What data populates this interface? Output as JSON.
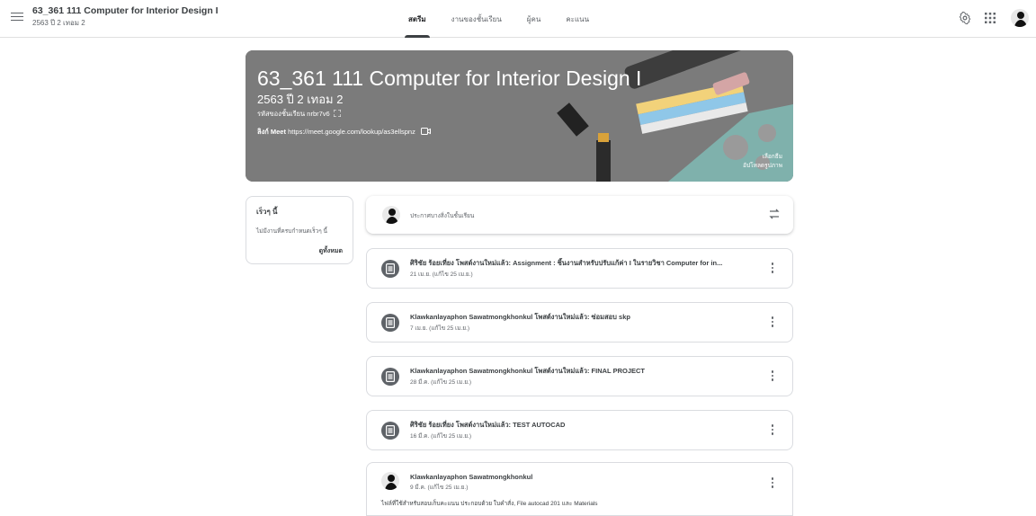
{
  "header": {
    "class_title": "63_361 111 Computer for Interior Design I",
    "class_subtitle": "2563 ปี 2 เทอม 2",
    "tabs": [
      {
        "label": "สตรีม",
        "active": true
      },
      {
        "label": "งานของชั้นเรียน",
        "active": false
      },
      {
        "label": "ผู้คน",
        "active": false
      },
      {
        "label": "คะแนน",
        "active": false
      }
    ]
  },
  "banner": {
    "title": "63_361 111 Computer for Interior Design I",
    "term": "2563 ปี 2 เทอม 2",
    "code_label": "รหัสของชั้นเรียน",
    "code_value": "nrbr7v6",
    "meet_label": "ลิงก์ Meet",
    "meet_url": "https://meet.google.com/lookup/as3ellspnz",
    "select_theme": "เลือกธีม",
    "upload_photo": "อัปโหลดรูปภาพ"
  },
  "upcoming": {
    "title": "เร็วๆ นี้",
    "empty": "ไม่มีงานที่ครบกำหนดเร็วๆ นี้",
    "view_all": "ดูทั้งหมด"
  },
  "announce": {
    "placeholder": "ประกาศบางสิ่งในชั้นเรียน"
  },
  "posts": [
    {
      "title": "ศิริชัย ร้อยเที่ยง โพสต์งานใหม่แล้ว: Assignment : ชิ้นงานสำหรับปรับแก้ค่า I ในรายวิชา Computer for in...",
      "date": "21 เม.ย. (แก้ไข 25 เม.ย.)"
    },
    {
      "title": "Klawkanlayaphon Sawatmongkhonkul โพสต์งานใหม่แล้ว: ซ่อมสอบ skp",
      "date": "7 เม.ย. (แก้ไข 25 เม.ย.)"
    },
    {
      "title": "Klawkanlayaphon Sawatmongkhonkul โพสต์งานใหม่แล้ว: FINAL PROJECT",
      "date": "28 มี.ค. (แก้ไข 25 เม.ย.)"
    },
    {
      "title": "ศิริชัย ร้อยเที่ยง โพสต์งานใหม่แล้ว: TEST AUTOCAD",
      "date": "16 มี.ค. (แก้ไข 25 เม.ย.)"
    }
  ],
  "last_post": {
    "author": "Klawkanlayaphon Sawatmongkhonkul",
    "date": "9 มี.ค. (แก้ไข 25 เม.ย.)",
    "body": "ไฟล์ที่ใช้สำหรับสอบเก็บคะแนน ประกอบด้วย ใบคำสั่ง, File autocad 201 และ Materials"
  },
  "colors": {
    "banner_bg": "#7a7a7a",
    "icon_gray": "#5f6368",
    "text": "#3c4043"
  }
}
